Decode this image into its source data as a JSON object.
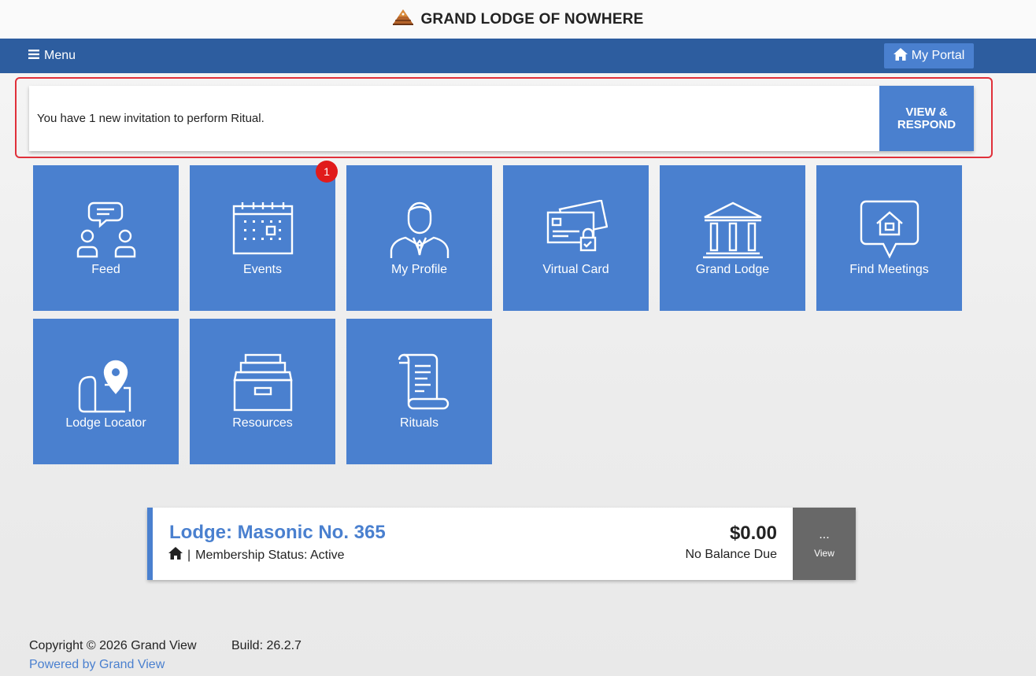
{
  "header": {
    "title": "GRAND LODGE OF NOWHERE",
    "logo_icon": "pyramid-logo-icon"
  },
  "navbar": {
    "menu_label": "Menu",
    "portal_label": "My Portal",
    "color": "#2d5d9f"
  },
  "alert": {
    "message": "You have 1 new invitation to perform Ritual.",
    "button_line1": "VIEW &",
    "button_line2": "RESPOND"
  },
  "tiles": [
    {
      "label": "Feed",
      "icon": "chat-people-icon"
    },
    {
      "label": "Events",
      "icon": "calendar-icon",
      "badge": "1"
    },
    {
      "label": "My Profile",
      "icon": "person-suit-icon"
    },
    {
      "label": "Virtual Card",
      "icon": "cards-lock-icon"
    },
    {
      "label": "Grand Lodge",
      "icon": "temple-icon"
    },
    {
      "label": "Find Meetings",
      "icon": "house-bubble-icon"
    },
    {
      "label": "Lodge Locator",
      "icon": "map-pin-icon"
    },
    {
      "label": "Resources",
      "icon": "file-drawer-icon"
    },
    {
      "label": "Rituals",
      "icon": "scroll-icon"
    }
  ],
  "lodge": {
    "name": "Lodge: Masonic No. 365",
    "status_separator": "|",
    "status": "Membership Status: Active",
    "balance": "$0.00",
    "balance_label": "No Balance Due",
    "view_dots": "...",
    "view_label": "View"
  },
  "footer": {
    "copyright": "Copyright © 2026 Grand View",
    "build": "Build: 26.2.7",
    "link": "Powered by Grand View"
  },
  "colors": {
    "tile": "#4a80cf",
    "alert_border": "#e0303a",
    "badge": "#e11b1b"
  }
}
